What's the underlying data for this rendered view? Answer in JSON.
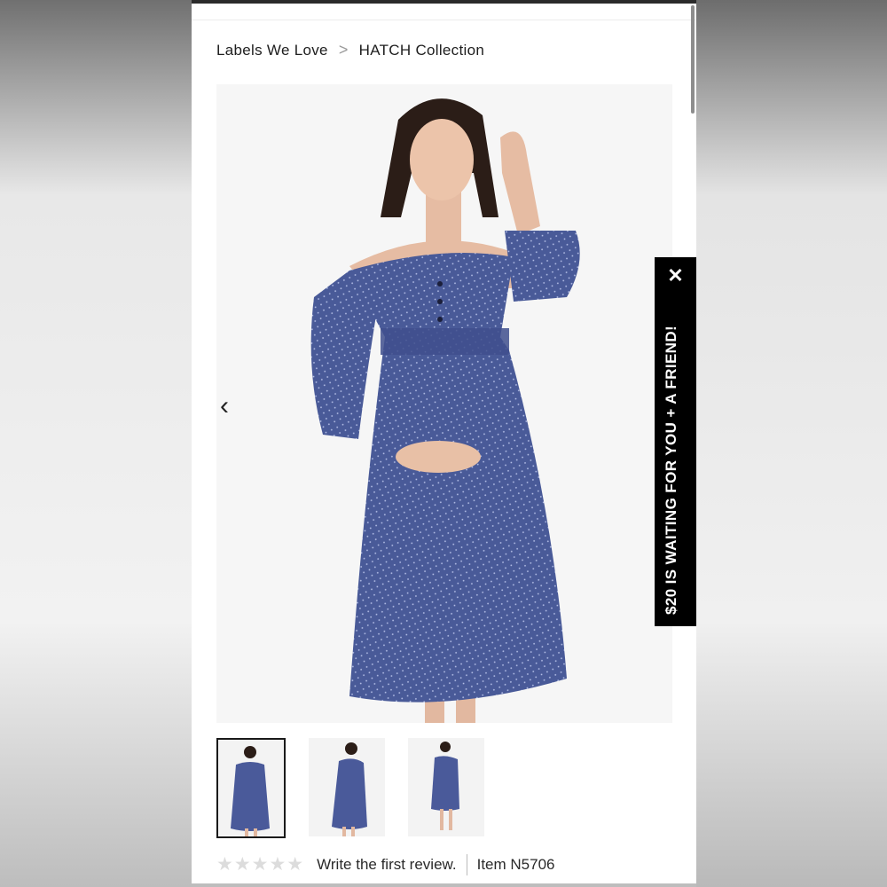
{
  "breadcrumb": {
    "items": [
      "Labels We Love",
      "HATCH Collection"
    ],
    "separator": ">"
  },
  "gallery": {
    "prev_icon": "‹",
    "main_image": "maternity-dress-model-front",
    "thumbnails": [
      "model-front",
      "model-side",
      "model-full-length"
    ],
    "active_index": 0
  },
  "reviews": {
    "stars": "★★★★★",
    "rating": 0,
    "write_label": "Write the first review.",
    "item_label": "Item N5706"
  },
  "promo": {
    "text": "$20 IS WAITING FOR YOU + A FRIEND!",
    "close_label": "✕"
  },
  "colors": {
    "dress": "#4a5a9a",
    "promo_bg": "#000000",
    "star_empty": "#dcdcdc"
  }
}
